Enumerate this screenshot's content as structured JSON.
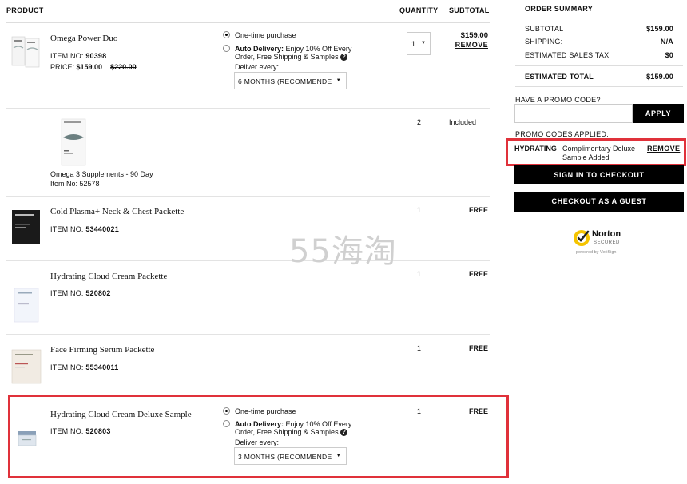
{
  "headers": {
    "product": "PRODUCT",
    "quantity": "QUANTITY",
    "subtotal": "SUBTOTAL"
  },
  "rows": [
    {
      "name": "Omega Power Duo",
      "item_label": "ITEM NO:",
      "item_no": "90398",
      "price_label": "PRICE:",
      "price": "$159.00",
      "price_old": "$220.00",
      "option_one_time": "One-time purchase",
      "auto_delivery_label": "Auto Delivery:",
      "auto_delivery_text": "Enjoy 10% Off Every Order, Free Shipping & Samples",
      "deliver_every": "Deliver every:",
      "deliver_select": "6 MONTHS (RECOMMENDE",
      "qty": "1",
      "subtotal": "$159.00",
      "remove": "REMOVE"
    },
    {
      "name": "Omega 3 Supplements - 90 Day",
      "item_label": "Item No:",
      "item_no": "52578",
      "qty": "2",
      "subtotal": "Included"
    },
    {
      "name": "Cold Plasma+ Neck & Chest Packette",
      "item_label": "ITEM NO:",
      "item_no": "53440021",
      "qty": "1",
      "subtotal": "FREE"
    },
    {
      "name": "Hydrating Cloud Cream Packette",
      "item_label": "ITEM NO:",
      "item_no": "520802",
      "qty": "1",
      "subtotal": "FREE"
    },
    {
      "name": "Face Firming Serum Packette",
      "item_label": "ITEM NO:",
      "item_no": "55340011",
      "qty": "1",
      "subtotal": "FREE"
    },
    {
      "name": "Hydrating Cloud Cream Deluxe Sample",
      "item_label": "ITEM NO:",
      "item_no": "520803",
      "option_one_time": "One-time purchase",
      "auto_delivery_label": "Auto Delivery:",
      "auto_delivery_text": "Enjoy 10% Off Every Order, Free Shipping & Samples",
      "deliver_every": "Deliver every:",
      "deliver_select": "3 MONTHS (RECOMMENDE",
      "qty": "1",
      "subtotal": "FREE"
    }
  ],
  "summary": {
    "title": "ORDER SUMMARY",
    "subtotal_label": "SUBTOTAL",
    "subtotal_value": "$159.00",
    "shipping_label": "SHIPPING:",
    "shipping_value": "N/A",
    "tax_label": "ESTIMATED SALES TAX",
    "tax_value": "$0",
    "total_label": "ESTIMATED TOTAL",
    "total_value": "$159.00"
  },
  "promo": {
    "question": "HAVE A PROMO CODE?",
    "input_placeholder": "",
    "apply": "APPLY",
    "applied_label": "PROMO CODES APPLIED:",
    "code": "HYDRATING",
    "code_desc": "Complimentary Deluxe Sample Added",
    "remove": "REMOVE"
  },
  "buttons": {
    "sign_in_checkout": "SIGN IN TO CHECKOUT",
    "guest_checkout": "CHECKOUT AS A GUEST"
  },
  "norton": {
    "brand": "Norton",
    "secured": "SECURED",
    "powered": "powered by VeriSign"
  },
  "watermark": "55海淘",
  "colors": {
    "highlight": "#e0313a",
    "button_bg": "#000000",
    "norton_yellow": "#f5c400"
  }
}
